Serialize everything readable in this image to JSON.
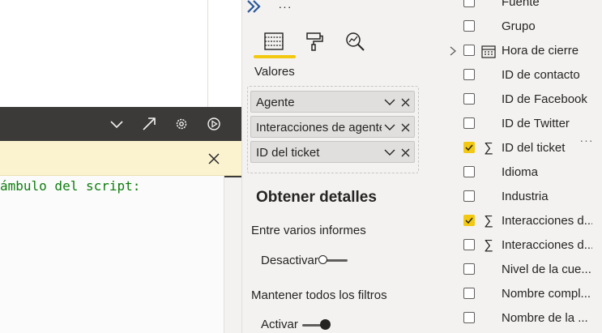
{
  "script_editor": {
    "preamble_text": "ámbulo del script:"
  },
  "visualizations": {
    "more_label": "···",
    "values_label": "Valores",
    "wells": [
      {
        "label": "Agente"
      },
      {
        "label": "Interacciones de agente"
      },
      {
        "label": "ID del ticket"
      }
    ],
    "details_title": "Obtener detalles",
    "cross_report_label": "Entre varios informes",
    "cross_report_toggle": {
      "label": "Desactivar",
      "on": false
    },
    "keep_filters_label": "Mantener todos los filtros",
    "keep_filters_toggle": {
      "label": "Activar",
      "on": true
    }
  },
  "fields": {
    "items": [
      {
        "name": "Fuente",
        "checked": false,
        "icon": ""
      },
      {
        "name": "Grupo",
        "checked": false,
        "icon": ""
      },
      {
        "name": "Hora de cierre",
        "checked": false,
        "icon": "calendar-icon",
        "expandable": true
      },
      {
        "name": "ID de contacto",
        "checked": false,
        "icon": ""
      },
      {
        "name": "ID de Facebook",
        "checked": false,
        "icon": ""
      },
      {
        "name": "ID de Twitter",
        "checked": false,
        "icon": ""
      },
      {
        "name": "ID del ticket",
        "checked": true,
        "icon": "sigma-icon"
      },
      {
        "name": "Idioma",
        "checked": false,
        "icon": ""
      },
      {
        "name": "Industria",
        "checked": false,
        "icon": ""
      },
      {
        "name": "Interacciones d...",
        "checked": true,
        "icon": "sigma-icon"
      },
      {
        "name": "Interacciones d...",
        "checked": false,
        "icon": "sigma-icon"
      },
      {
        "name": "Nivel de la cue...",
        "checked": false,
        "icon": ""
      },
      {
        "name": "Nombre compl...",
        "checked": false,
        "icon": ""
      },
      {
        "name": "Nombre de la ...",
        "checked": false,
        "icon": ""
      }
    ],
    "more_label": "···"
  },
  "colors": {
    "accent": "#f2c811",
    "banner": "#fbf3d0",
    "header_dark": "#3b3a39",
    "script_text": "#0e7d0e"
  }
}
